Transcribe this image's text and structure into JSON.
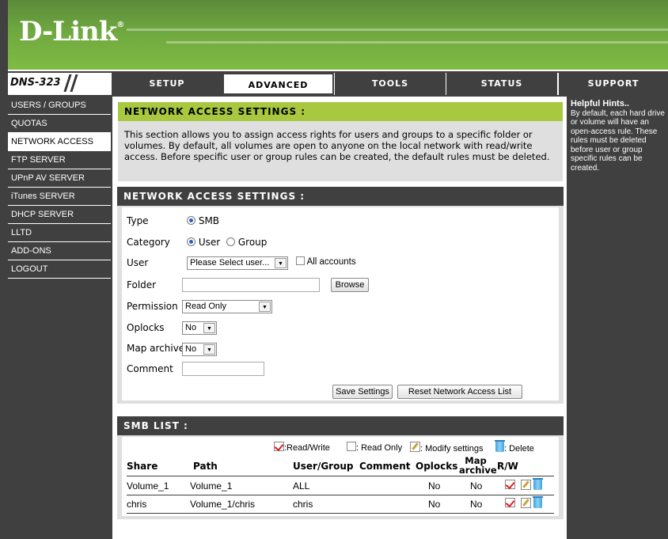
{
  "brand": {
    "logo": "D-Link",
    "reg": "®",
    "model": "DNS-323"
  },
  "nav": {
    "tabs": [
      "SETUP",
      "ADVANCED",
      "TOOLS",
      "STATUS"
    ],
    "support": "SUPPORT"
  },
  "sidebar": {
    "items": [
      "USERS / GROUPS",
      "QUOTAS",
      "NETWORK ACCESS",
      "FTP SERVER",
      "UPnP AV SERVER",
      "iTunes SERVER",
      "DHCP SERVER",
      "LLTD",
      "ADD-ONS",
      "LOGOUT"
    ]
  },
  "intro": {
    "title": "NETWORK ACCESS SETTINGS :",
    "text": "This section allows you to assign access rights for users and groups to a specific folder or volumes. By default, all volumes are open to anyone on the local network with read/write access. Before specific user or group rules can be created, the default rules must be deleted."
  },
  "form": {
    "title": "NETWORK ACCESS SETTINGS :",
    "type_label": "Type",
    "type_smb": "SMB",
    "category_label": "Category",
    "category_user": "User",
    "category_group": "Group",
    "user_label": "User",
    "user_value": "Please Select user...",
    "all_accounts": "All accounts",
    "folder_label": "Folder",
    "folder_value": "",
    "browse": "Browse",
    "permission_label": "Permission",
    "permission_value": "Read Only",
    "oplocks_label": "Oplocks",
    "oplocks_value": "No",
    "map_archive_label": "Map archive",
    "map_archive_value": "No",
    "comment_label": "Comment",
    "comment_value": "",
    "save": "Save Settings",
    "reset": "Reset Network Access List"
  },
  "smb": {
    "title": "SMB LIST :",
    "legend": {
      "rw": ":Read/Write",
      "ro": ": Read Only",
      "modify": ": Modify settings",
      "delete": ": Delete"
    },
    "headers": {
      "share": "Share",
      "path": "Path",
      "usergroup": "User/Group",
      "comment": "Comment",
      "oplocks": "Oplocks",
      "map_archive": "Map archive",
      "rw": "R/W"
    },
    "rows": [
      {
        "share": "Volume_1",
        "path": "Volume_1",
        "usergroup": "ALL",
        "comment": "",
        "oplocks": "No",
        "map_archive": "No"
      },
      {
        "share": "chris",
        "path": "Volume_1/chris",
        "usergroup": "chris",
        "comment": "",
        "oplocks": "No",
        "map_archive": "No"
      }
    ]
  },
  "hints": {
    "title": "Helpful Hints..",
    "text": "By default, each hard drive or volume will have an open-access rule. These rules must be deleted before user or group specific rules can be created."
  }
}
